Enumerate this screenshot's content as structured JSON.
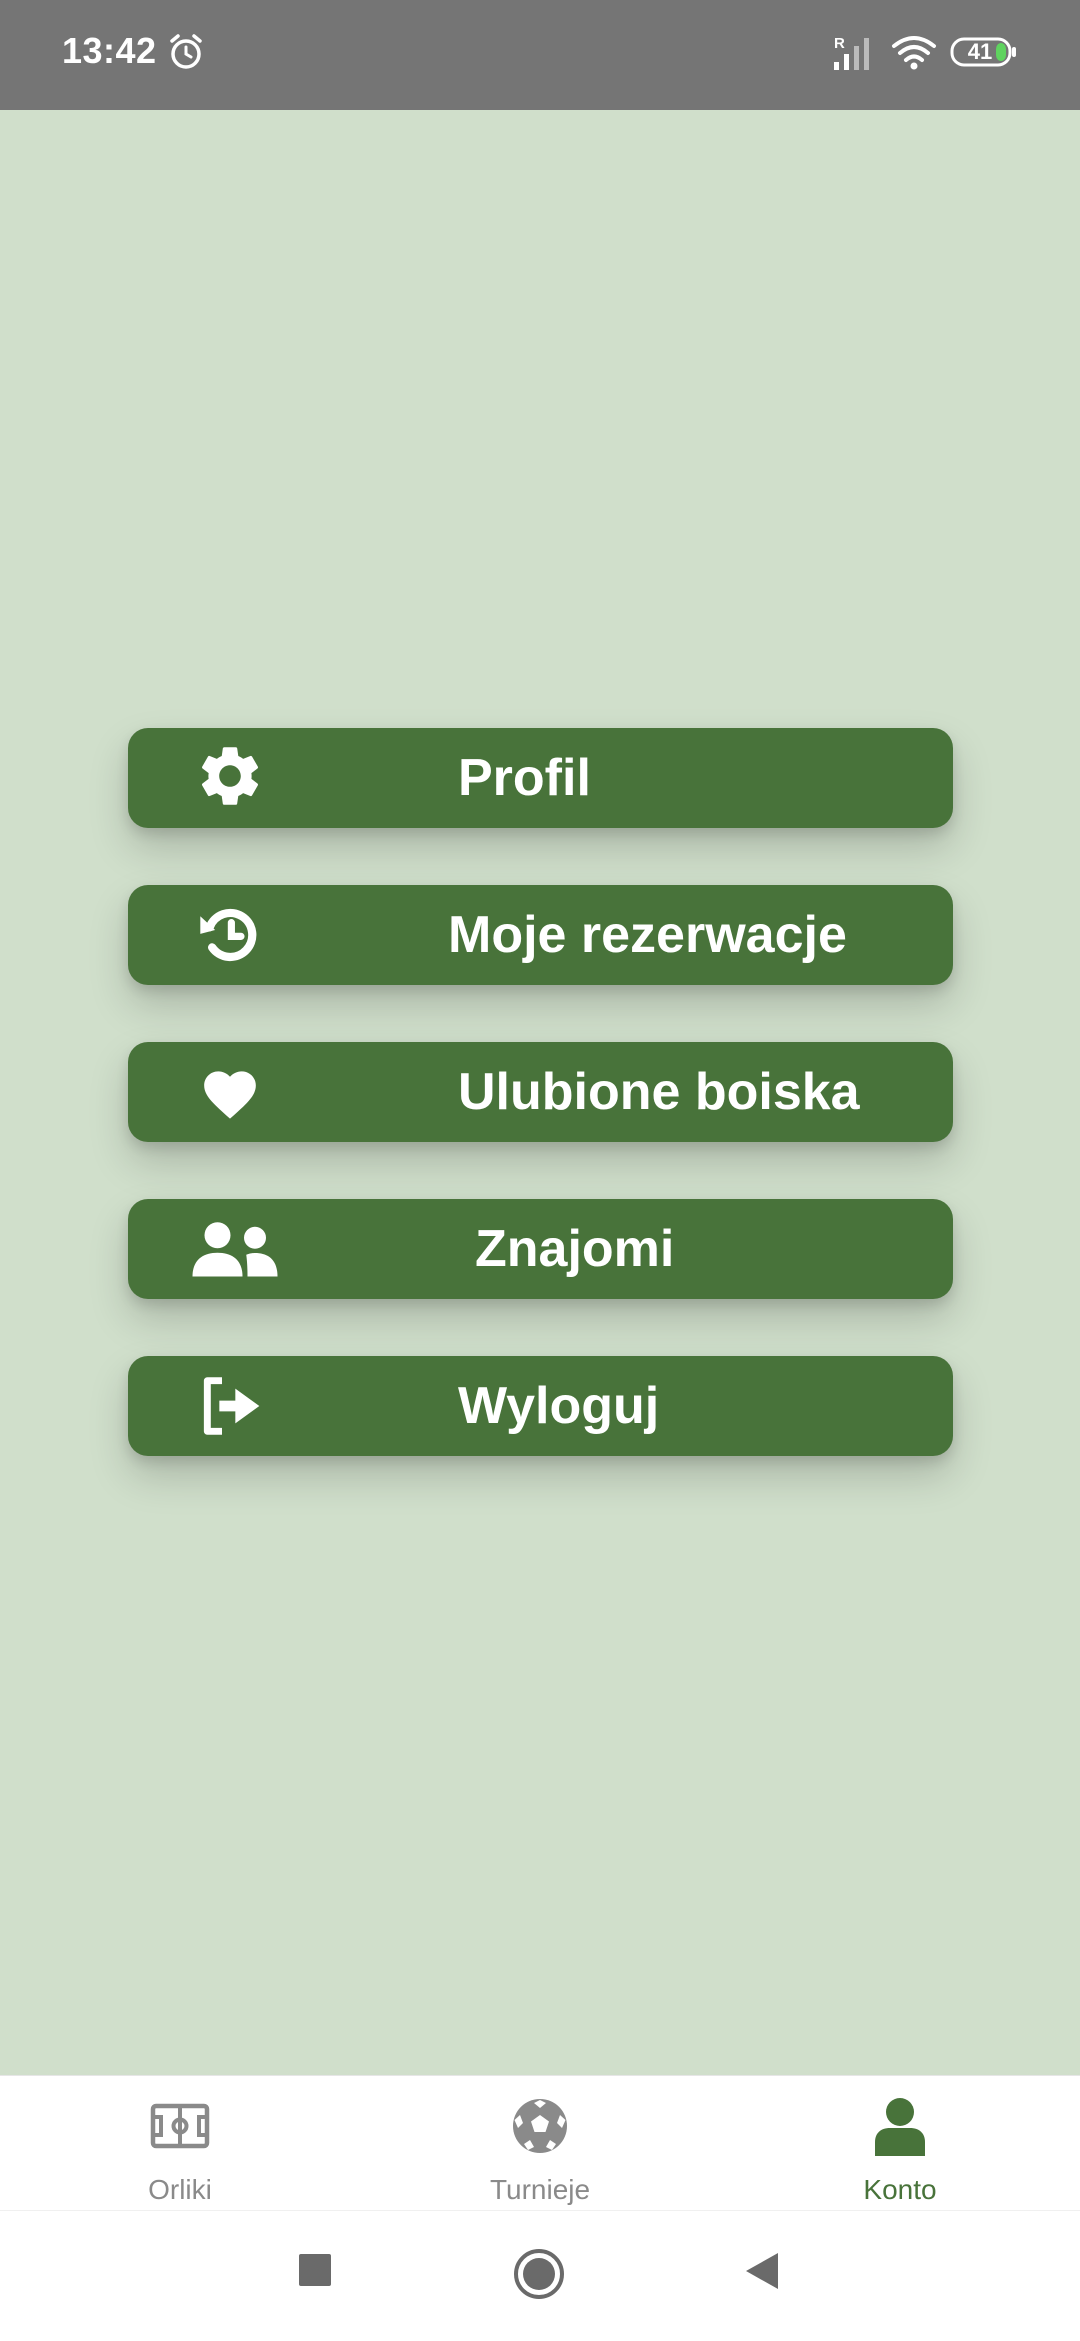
{
  "status_bar": {
    "time": "13:42",
    "battery": "41",
    "network_badge": "R"
  },
  "menu": {
    "items": [
      {
        "label": "Profil",
        "icon": "gear-icon"
      },
      {
        "label": "Moje rezerwacje",
        "icon": "history-icon"
      },
      {
        "label": "Ulubione boiska",
        "icon": "heart-icon"
      },
      {
        "label": "Znajomi",
        "icon": "users-icon"
      },
      {
        "label": "Wyloguj",
        "icon": "sign-out-icon"
      }
    ]
  },
  "bottom_nav": {
    "items": [
      {
        "label": "Orliki",
        "icon": "pitch-icon",
        "active": false
      },
      {
        "label": "Turnieje",
        "icon": "soccer-ball-icon",
        "active": false
      },
      {
        "label": "Konto",
        "icon": "user-icon",
        "active": true
      }
    ]
  },
  "colors": {
    "background": "#d0dfcb",
    "button": "#48733a",
    "status_bar": "#757575",
    "nav_active": "#48733a",
    "nav_inactive": "#8a8a8a"
  }
}
